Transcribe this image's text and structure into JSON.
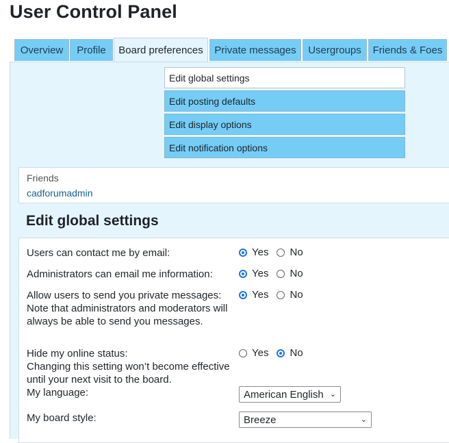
{
  "page": {
    "title": "User Control Panel"
  },
  "tabs": [
    {
      "label": "Overview",
      "active": false
    },
    {
      "label": "Profile",
      "active": false
    },
    {
      "label": "Board preferences",
      "active": true
    },
    {
      "label": "Private messages",
      "active": false
    },
    {
      "label": "Usergroups",
      "active": false
    },
    {
      "label": "Friends & Foes",
      "active": false
    }
  ],
  "submenu": [
    {
      "label": "Edit global settings",
      "active": true
    },
    {
      "label": "Edit posting defaults",
      "active": false
    },
    {
      "label": "Edit display options",
      "active": false
    },
    {
      "label": "Edit notification options",
      "active": false
    }
  ],
  "friends": {
    "label": "Friends",
    "link": "cadforumadmin"
  },
  "section": {
    "title": "Edit global settings"
  },
  "settings": {
    "yes_label": "Yes",
    "no_label": "No",
    "contact_email": {
      "label": "Users can contact me by email:",
      "value": "Yes"
    },
    "admin_email": {
      "label": "Administrators can email me information:",
      "value": "Yes"
    },
    "allow_pm": {
      "label": "Allow users to send you private messages:",
      "note": "Note that administrators and moderators will always be able to send you messages.",
      "value": "Yes"
    },
    "hide_online": {
      "label": "Hide my online status:",
      "note": "Changing this setting won’t become effective until your next visit to the board.",
      "value": "No"
    },
    "language": {
      "label": "My language:",
      "value": "American English"
    },
    "style": {
      "label": "My board style:",
      "value": "Breeze"
    }
  },
  "colors": {
    "tab": "#75cdf6",
    "panel": "#e5f5fd",
    "link": "#1a5f92",
    "radio": "#1a73e8"
  }
}
